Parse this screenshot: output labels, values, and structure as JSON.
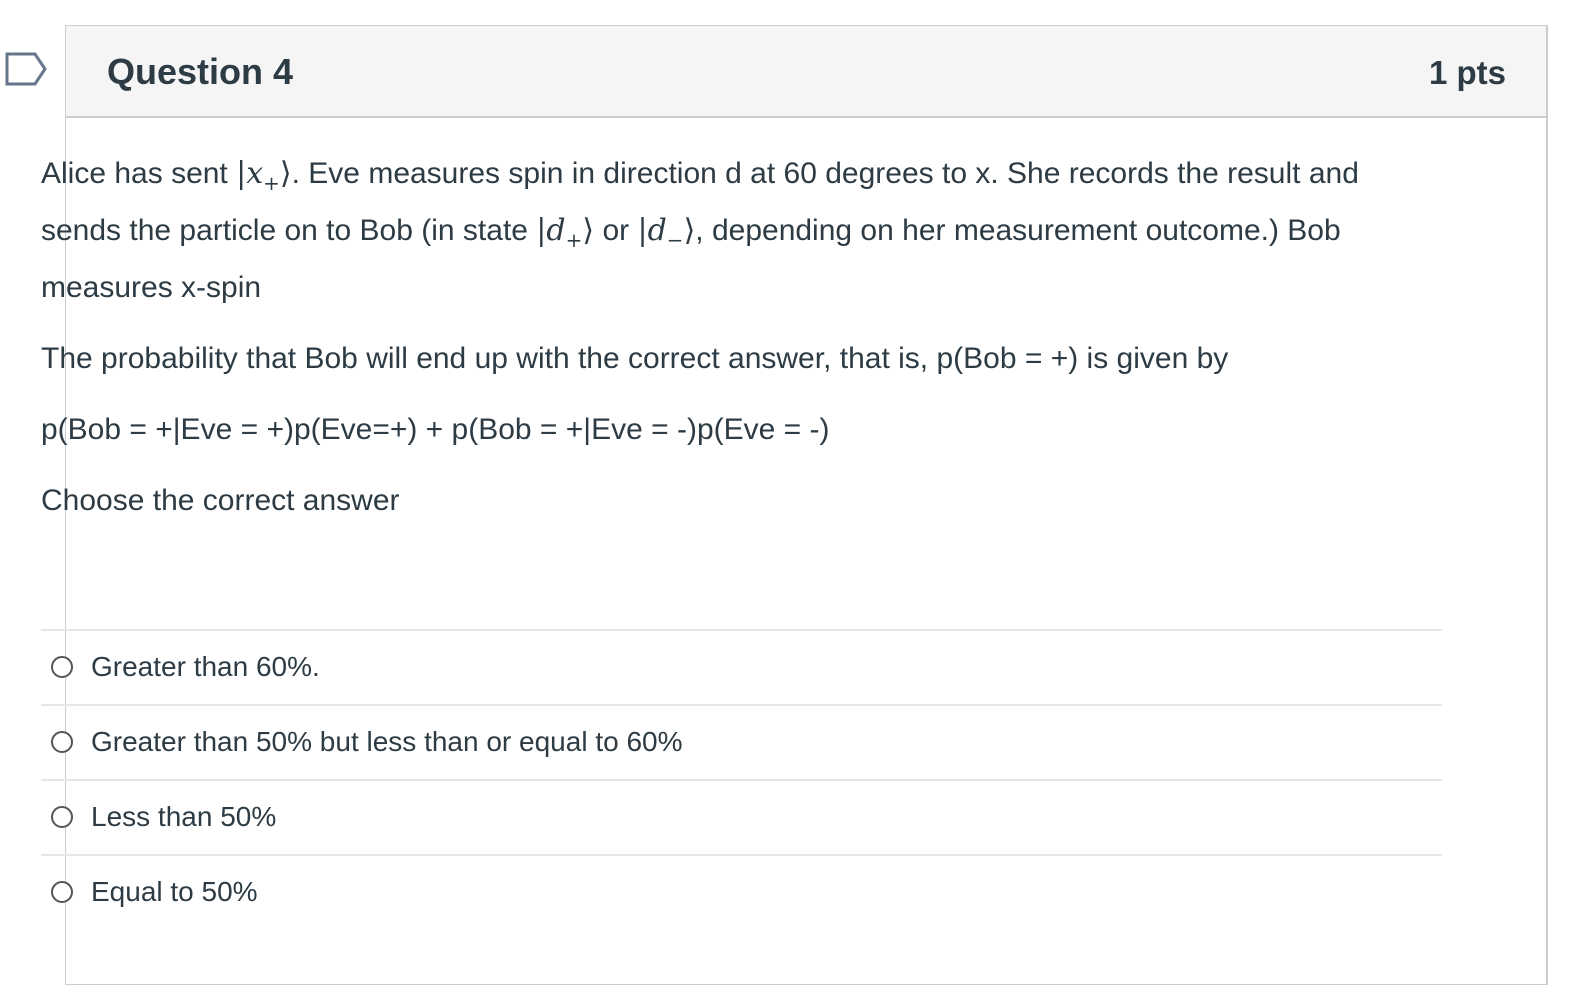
{
  "question": {
    "title": "Question 4",
    "points": "1 pts",
    "text": {
      "p1_part1": "Alice has sent ",
      "state_x": "x",
      "state_x_sub": "+",
      "p1_part2": ". Eve measures spin in direction d at 60 degrees to x. She records the result and sends the particle on to Bob (in state ",
      "state_d": "d",
      "state_d_plus_sub": "+",
      "p1_or": " or ",
      "state_d_minus_sub": "−",
      "p1_part3": ", depending on her measurement outcome.) Bob measures x-spin",
      "p2": "The probability that Bob will end up with the correct answer, that is, p(Bob = +) is given by",
      "p3": "p(Bob = +|Eve = +)p(Eve=+) + p(Bob = +|Eve = -)p(Eve = -)",
      "p4": "Choose the correct answer"
    },
    "answers": [
      {
        "label": "Greater than 60%."
      },
      {
        "label": "Greater than 50% but less than or equal to 60%"
      },
      {
        "label": "Less than 50%"
      },
      {
        "label": "Equal to 50%"
      }
    ]
  },
  "colors": {
    "text": "#2d3b45",
    "header_bg": "#f5f5f5",
    "border": "#c7cdd1",
    "flag": "#66758b"
  },
  "icons": {
    "flag": "flag-icon"
  }
}
